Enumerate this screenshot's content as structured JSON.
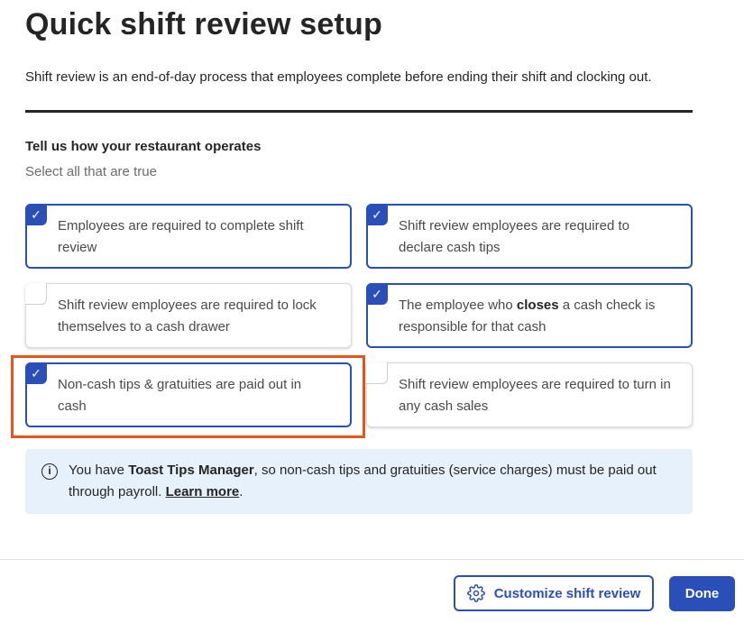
{
  "header": {
    "title": "Quick shift review setup",
    "intro": "Shift review is an end-of-day process that employees complete before ending their shift and clocking out."
  },
  "section": {
    "title": "Tell us how your restaurant operates",
    "subtitle": "Select all that are true"
  },
  "options": [
    {
      "label": "Employees are required to complete shift review",
      "checked": true
    },
    {
      "label": "Shift review employees are required to declare cash tips",
      "checked": true
    },
    {
      "label": "Shift review employees are required to lock themselves to a cash drawer",
      "checked": false
    },
    {
      "label_before": "The employee who ",
      "label_bold": "closes",
      "label_after": " a cash check is responsible for that cash",
      "checked": true
    },
    {
      "label": "Non-cash tips & gratuities are paid out in cash",
      "checked": true
    },
    {
      "label": "Shift review employees are required to turn in any cash sales",
      "checked": false
    }
  ],
  "info": {
    "icon": "info-icon",
    "text_before": "You have ",
    "text_bold": "Toast Tips Manager",
    "text_after": ", so non-cash tips and gratuities (service charges) must be paid out through payroll. ",
    "link": "Learn more",
    "text_end": "."
  },
  "footer": {
    "customize_label": "Customize shift review",
    "customize_icon": "gear-icon",
    "done_label": "Done"
  },
  "colors": {
    "accent": "#2b4fb9",
    "highlight": "#e8531a",
    "info_bg": "#e6f1fb"
  }
}
